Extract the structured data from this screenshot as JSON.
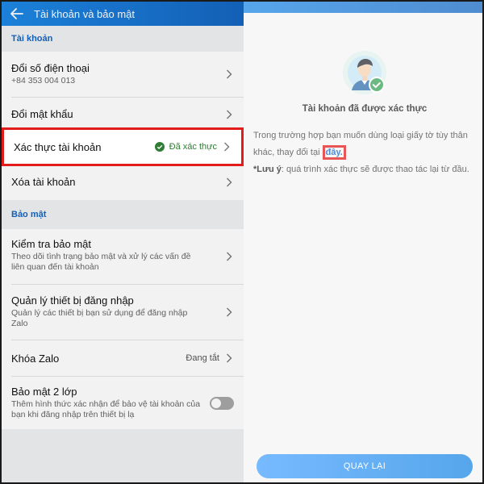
{
  "header": {
    "title": "Tài khoản và bảo mật"
  },
  "sections": {
    "account": {
      "title": "Tài khoản",
      "items": [
        {
          "label": "Đổi số điện thoại",
          "sub": "+84 353 004 013"
        },
        {
          "label": "Đổi mật khẩu"
        },
        {
          "label": "Xác thực tài khoản",
          "status": "Đã xác thực"
        },
        {
          "label": "Xóa tài khoản"
        }
      ]
    },
    "security": {
      "title": "Bảo mật",
      "items": [
        {
          "label": "Kiểm tra bảo mật",
          "sub": "Theo dõi tình trạng bảo mật và xử lý các vấn đề liên quan đến tài khoản"
        },
        {
          "label": "Quản lý thiết bị đăng nhập",
          "sub": "Quản lý các thiết bị bạn sử dụng để đăng nhập Zalo"
        },
        {
          "label": "Khóa Zalo",
          "status": "Đang tắt"
        },
        {
          "label": "Bảo mật 2 lớp",
          "sub": "Thêm hình thức xác nhận để bảo vệ tài khoản của bạn khi đăng nhập trên thiết bị lạ",
          "toggle": "off"
        }
      ]
    }
  },
  "verified_panel": {
    "title": "Tài khoản đã được xác thực",
    "info_prefix": "Trong trường hợp bạn muốn dùng loại giấy tờ tùy thân khác, thay đổi tại ",
    "info_link": "đây.",
    "note_label": "*Lưu ý",
    "note_text": ": quá trình xác thực sẽ được thao tác lại từ đầu.",
    "back_button": "QUAY LẠI"
  },
  "colors": {
    "brand": "#1e88e5",
    "highlight": "#e21b1b",
    "success": "#2e7d32"
  },
  "icons": {
    "back": "back-arrow-icon",
    "chevron": "chevron-right-icon",
    "verified": "check-circle-icon",
    "avatar": "user-avatar-icon"
  }
}
